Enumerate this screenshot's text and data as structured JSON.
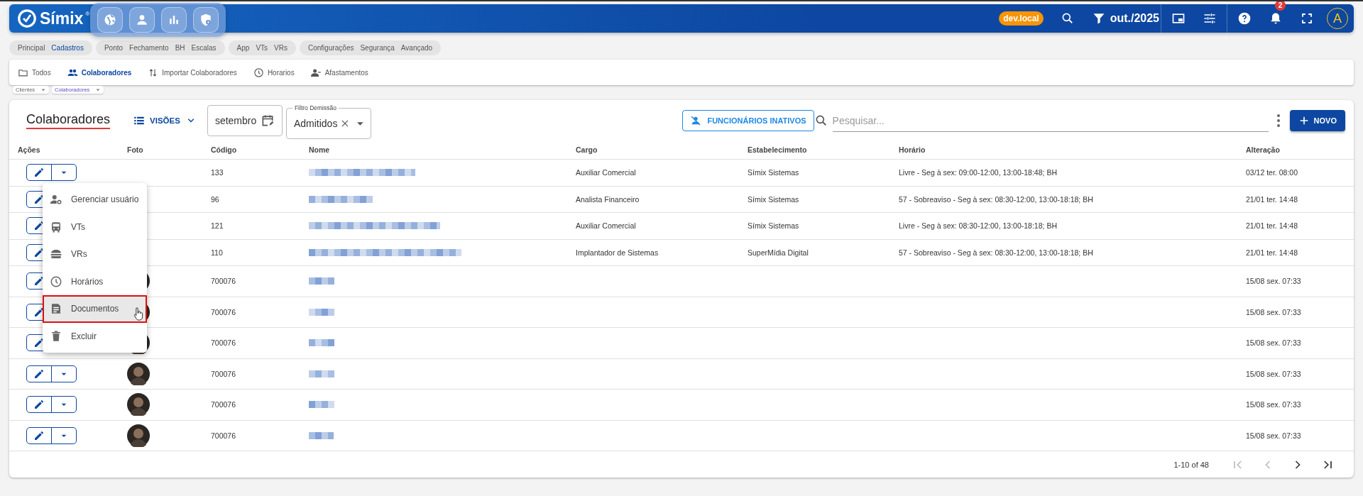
{
  "topbar": {
    "logo": "Símix",
    "logo_mark": "®",
    "badge": "dev.local",
    "period": "out./2025",
    "notifications": "2",
    "avatar": "A"
  },
  "nav_groups": [
    {
      "items": [
        {
          "label": "Principal",
          "selected": false
        },
        {
          "label": "Cadastros",
          "selected": true
        }
      ]
    },
    {
      "items": [
        {
          "label": "Ponto",
          "selected": false
        },
        {
          "label": "Fechamento",
          "selected": false
        },
        {
          "label": "BH",
          "selected": false
        },
        {
          "label": "Escalas",
          "selected": false
        }
      ]
    },
    {
      "items": [
        {
          "label": "App",
          "selected": false
        },
        {
          "label": "VTs",
          "selected": false
        },
        {
          "label": "VRs",
          "selected": false
        }
      ]
    },
    {
      "items": [
        {
          "label": "Configurações",
          "selected": false
        },
        {
          "label": "Segurança",
          "selected": false
        },
        {
          "label": "Avançado",
          "selected": false
        }
      ]
    }
  ],
  "tabs": [
    {
      "label": "Todos",
      "selected": false
    },
    {
      "label": "Colaboradores",
      "selected": true
    },
    {
      "label": "Importar Colaboradores",
      "selected": false
    },
    {
      "label": "Horarios",
      "selected": false
    },
    {
      "label": "Afastamentos",
      "selected": false
    }
  ],
  "breadcrumbs": [
    {
      "label": "Clientes",
      "selected": false
    },
    {
      "label": "Colaboradores",
      "selected": true
    }
  ],
  "header": {
    "title": "Colaboradores",
    "views_button": "VISÕES",
    "date_field": {
      "value": "setembro"
    },
    "filter": {
      "label": "Filtro Demissão",
      "value": "Admitidos"
    },
    "inactive_button": "FUNCIONÁRIOS INATIVOS",
    "search": {
      "placeholder": "Pesquisar..."
    },
    "new_button": "NOVO"
  },
  "table": {
    "columns": [
      "Ações",
      "Foto",
      "Código",
      "Nome",
      "Cargo",
      "Estabelecimento",
      "Horário",
      "Alteração"
    ],
    "rows": [
      {
        "photo": false,
        "code": "133",
        "cargo": "Auxiliar Comercial",
        "estabelecimento": "Símix Sistemas",
        "horario": "Livre - Seg à sex: 09:00-12:00, 13:00-18:48; BH",
        "alteracao": "03/12 ter. 08:00"
      },
      {
        "photo": false,
        "code": "96",
        "cargo": "Analista Financeiro",
        "estabelecimento": "Símix Sistemas",
        "horario": "57 - Sobreaviso - Seg à sex: 08:30-12:00, 13:00-18:18; BH",
        "alteracao": "21/01 ter. 14:48"
      },
      {
        "photo": false,
        "code": "121",
        "cargo": "Auxiliar Comercial",
        "estabelecimento": "Símix Sistemas",
        "horario": "Livre - Seg à sex: 08:30-12:00, 13:00-18:18; BH",
        "alteracao": "21/01 ter. 14:48"
      },
      {
        "photo": false,
        "code": "110",
        "cargo": "Implantador de Sistemas",
        "estabelecimento": "SuperMídia Digital",
        "horario": "57 - Sobreaviso - Seg à sex: 08:30-12:00, 13:00-18:18; BH",
        "alteracao": "21/01 ter. 14:48"
      },
      {
        "photo": true,
        "code": "700076",
        "alteracao": "15/08 sex. 07:33"
      },
      {
        "photo": true,
        "code": "700076",
        "alteracao": "15/08 sex. 07:33"
      },
      {
        "photo": true,
        "code": "700076",
        "alteracao": "15/08 sex. 07:33"
      },
      {
        "photo": true,
        "code": "700076",
        "alteracao": "15/08 sex. 07:33"
      },
      {
        "photo": true,
        "code": "700076",
        "alteracao": "15/08 sex. 07:33"
      },
      {
        "photo": true,
        "code": "700076",
        "alteracao": "15/08 sex. 07:33"
      }
    ]
  },
  "menu": {
    "items": [
      {
        "label": "Gerenciar usuário",
        "highlighted": false
      },
      {
        "label": "VTs",
        "highlighted": false
      },
      {
        "label": "VRs",
        "highlighted": false
      },
      {
        "label": "Horários",
        "highlighted": false
      },
      {
        "label": "Documentos",
        "highlighted": true
      },
      {
        "label": "Excluir",
        "highlighted": false
      }
    ]
  },
  "pagination": {
    "range": "1-10 of 48",
    "first_disabled": true,
    "prev_disabled": true,
    "next_disabled": false,
    "last_disabled": false
  }
}
